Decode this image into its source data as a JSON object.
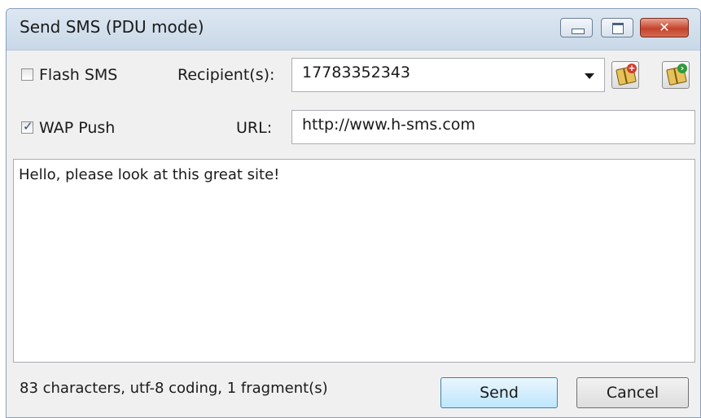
{
  "window": {
    "title": "Send SMS (PDU mode)",
    "controls": {
      "minimize": "minimize-icon",
      "maximize": "maximize-icon",
      "close": "close-icon"
    }
  },
  "options": {
    "flash_sms": {
      "label": "Flash SMS",
      "checked": false
    },
    "wap_push": {
      "label": "WAP Push",
      "checked": true
    }
  },
  "recipients": {
    "label": "Recipient(s):",
    "value": "17783352343",
    "buttons": [
      {
        "icon": "address-book-add-icon"
      },
      {
        "icon": "address-book-open-icon"
      }
    ]
  },
  "url": {
    "label": "URL:",
    "value": "http://www.h-sms.com"
  },
  "message": {
    "text": "Hello, please look at this great site!"
  },
  "status": "83 characters, utf-8 coding, 1 fragment(s)",
  "buttons": {
    "send": "Send",
    "cancel": "Cancel"
  }
}
